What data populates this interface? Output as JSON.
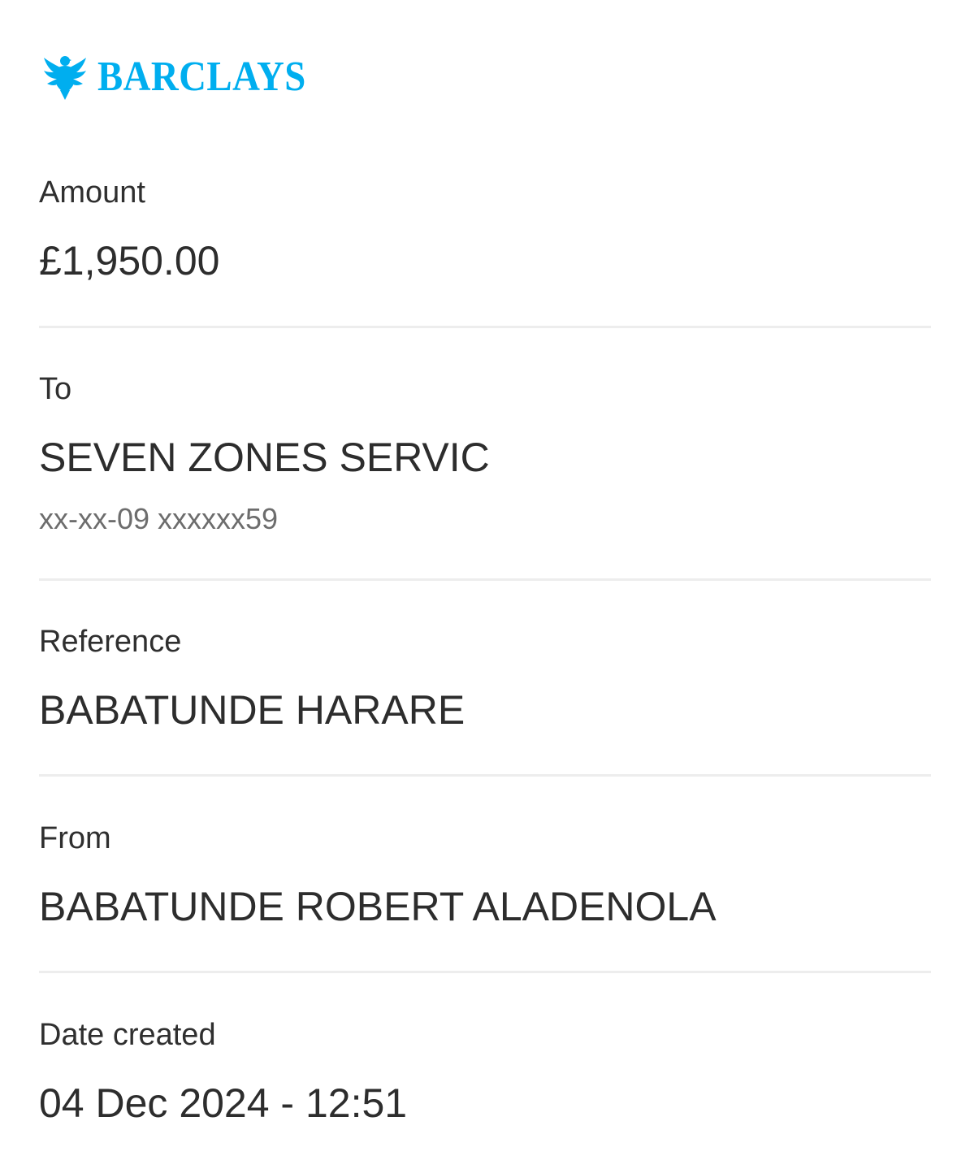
{
  "brand": {
    "name": "BARCLAYS",
    "logo_icon": "eagle-icon",
    "color": "#00AEEF"
  },
  "details": {
    "amount": {
      "label": "Amount",
      "value": "£1,950.00"
    },
    "to": {
      "label": "To",
      "value": "SEVEN ZONES SERVIC",
      "account": "xx-xx-09 xxxxxx59"
    },
    "reference": {
      "label": "Reference",
      "value": "BABATUNDE HARARE"
    },
    "from": {
      "label": "From",
      "value": "BABATUNDE ROBERT ALADENOLA"
    },
    "date_created": {
      "label": "Date created",
      "value": "04 Dec 2024 - 12:51"
    }
  },
  "colors": {
    "text": "#2d2d2d",
    "muted": "#6d6d6d",
    "divider": "#ededed"
  }
}
